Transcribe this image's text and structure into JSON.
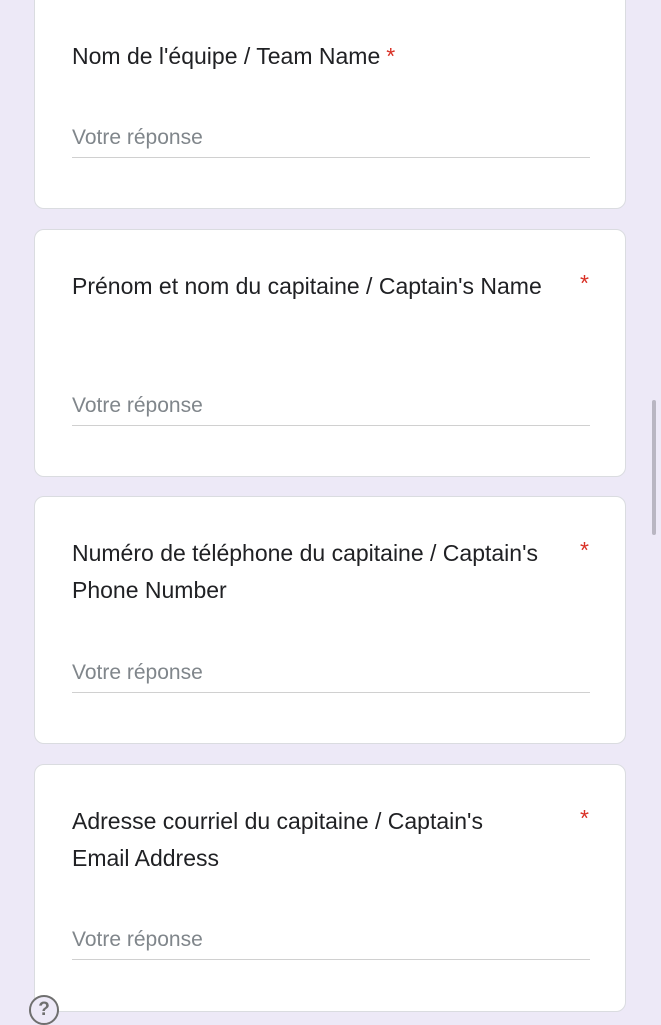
{
  "form": {
    "questions": [
      {
        "title": "Nom de l'équipe / Team Name",
        "required_mark": "*",
        "placeholder": "Votre réponse"
      },
      {
        "title": "Prénom et nom du capitaine / Captain's Name",
        "required_mark": "*",
        "placeholder": "Votre réponse"
      },
      {
        "title": "Numéro de téléphone du capitaine / Captain's Phone Number",
        "required_mark": "*",
        "placeholder": "Votre réponse"
      },
      {
        "title": "Adresse courriel du capitaine / Captain's Email Address",
        "required_mark": "*",
        "placeholder": "Votre réponse"
      }
    ]
  },
  "help": {
    "label": "?"
  },
  "colors": {
    "background": "#ede9f7",
    "card": "#ffffff",
    "required": "#d93025",
    "placeholder": "#80868b"
  }
}
